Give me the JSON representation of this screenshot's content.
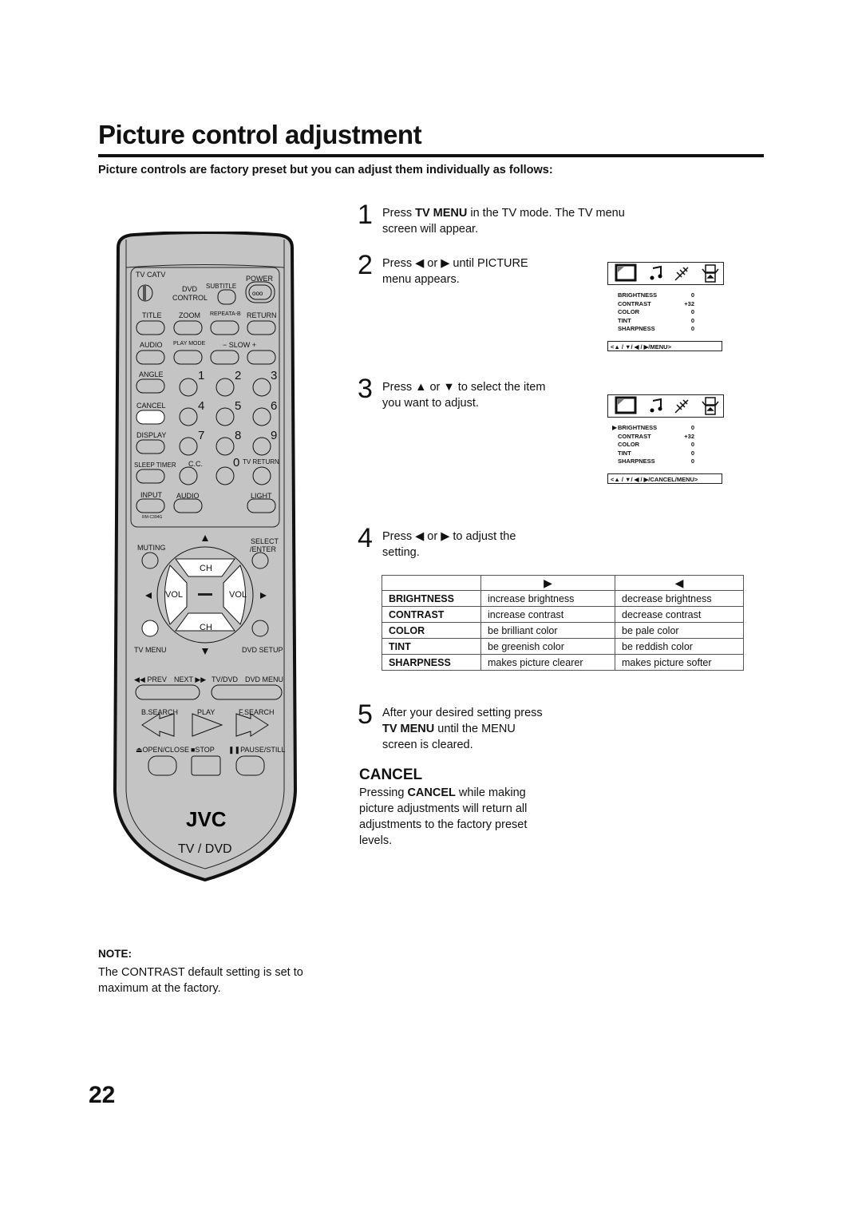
{
  "page": {
    "title": "Picture control adjustment",
    "intro": "Picture controls are factory preset but you can adjust them individually as follows:",
    "page_number": "22"
  },
  "steps": [
    {
      "num": "1",
      "pre": "Press ",
      "bold": "TV MENU",
      "post": " in the TV mode. The TV menu",
      "line2": "screen will appear."
    },
    {
      "num": "2",
      "pre": "Press ",
      "icon1": "◀",
      "mid": " or ",
      "icon2": "▶",
      "post": " until PICTURE",
      "line2": "menu appears."
    },
    {
      "num": "3",
      "pre": "Press ",
      "icon1": "▲",
      "mid": " or ",
      "icon2": "▼",
      "post": " to select the item",
      "line2": "you want to adjust."
    },
    {
      "num": "4",
      "pre": "Press ",
      "icon1": "◀",
      "mid": " or ",
      "icon2": "▶",
      "post": " to adjust the",
      "line2": "setting."
    },
    {
      "num": "5",
      "line1": "After your desired setting press",
      "bold": "TV MENU",
      "post": " until the MENU",
      "line3": "screen is cleared."
    }
  ],
  "osd": {
    "items": [
      {
        "name": "BRIGHTNESS",
        "value": "0"
      },
      {
        "name": "CONTRAST",
        "value": "+32"
      },
      {
        "name": "COLOR",
        "value": "0"
      },
      {
        "name": "TINT",
        "value": "0"
      },
      {
        "name": "SHARPNESS",
        "value": "0"
      }
    ],
    "bar1": "<▲ / ▼/ ◀ / ▶/MENU>",
    "bar2": "<▲ / ▼/ ◀ / ▶/CANCEL/MENU>",
    "pointer": "▶",
    "icons": [
      "picture-icon",
      "sound-icon",
      "antenna-icon",
      "setup-icon"
    ]
  },
  "table": {
    "head": [
      "",
      "▶",
      "◀"
    ],
    "rows": [
      [
        "BRIGHTNESS",
        "increase brightness",
        "decrease brightness"
      ],
      [
        "CONTRAST",
        "increase contrast",
        "decrease contrast"
      ],
      [
        "COLOR",
        "be brilliant color",
        "be pale color"
      ],
      [
        "TINT",
        "be greenish color",
        "be reddish color"
      ],
      [
        "SHARPNESS",
        "makes picture clearer",
        "makes picture softer"
      ]
    ]
  },
  "cancel": {
    "heading": "CANCEL",
    "pre": "Pressing ",
    "bold": "CANCEL",
    "post": " while making picture adjustments will return all adjustments to the factory preset levels."
  },
  "note": {
    "heading": "NOTE:",
    "body": "The CONTRAST default setting is set to maximum at the factory."
  },
  "remote": {
    "brand": "JVC",
    "model_label": "TV / DVD",
    "model_code": "RM-C394G",
    "labels": {
      "tv": "TV",
      "catv": "CATV",
      "power": "POWER",
      "dvd": "DVD",
      "control": "CONTROL",
      "subtitle": "SUBTITLE",
      "title": "TITLE",
      "zoom": "ZOOM",
      "repeat": "REPEATA-B",
      "return": "RETURN",
      "audio": "AUDIO",
      "playmode": "PLAY MODE",
      "slow": "− SLOW +",
      "angle": "ANGLE",
      "cancel": "CANCEL",
      "display": "DISPLAY",
      "sleep": "SLEEP TIMER",
      "cc": "C.C.",
      "tvreturn": "TV RETURN",
      "input": "INPUT",
      "audio2": "AUDIO",
      "light": "LIGHT",
      "muting": "MUTING",
      "select": "SELECT",
      "enter": "/ENTER",
      "ch": "CH",
      "vol": "VOL",
      "tvmenu": "TV MENU",
      "dvdsetup": "DVD SETUP",
      "prev": "◀◀ PREV",
      "next": "NEXT ▶▶",
      "tvdvd": "TV/DVD",
      "dvdmenu": "DVD MENU",
      "bsearch": "B.SEARCH",
      "play": "PLAY",
      "fsearch": "F.SEARCH",
      "open": "⏏OPEN/CLOSE",
      "stop": "■STOP",
      "pause": "❚❚PAUSE/STILL"
    },
    "digits": [
      "1",
      "2",
      "3",
      "4",
      "5",
      "6",
      "7",
      "8",
      "9",
      "0"
    ]
  },
  "colors": {
    "remote_body": "#c4c4c4",
    "ink": "#111111"
  }
}
